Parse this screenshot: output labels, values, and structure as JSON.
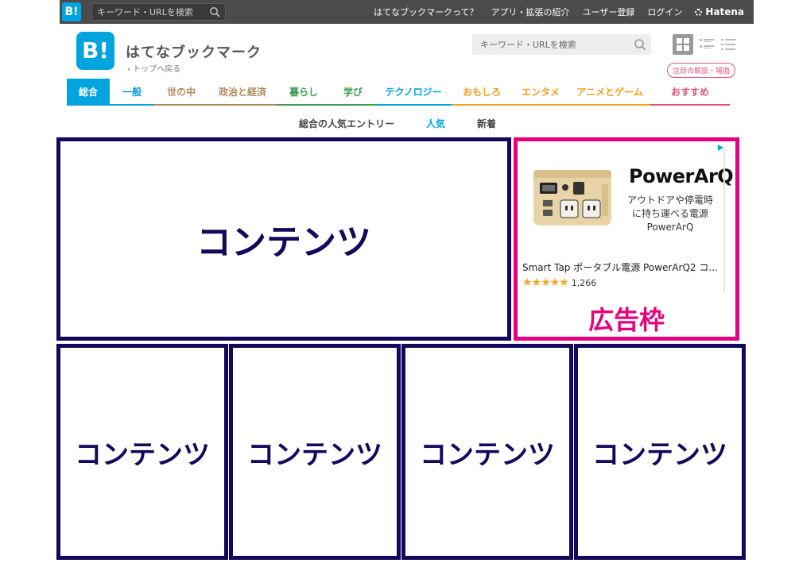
{
  "topbar": {
    "logo": "B!",
    "search_placeholder": "キーワード・URLを検索",
    "links": [
      "はてなブックマークって？",
      "アプリ・拡張の紹介",
      "ユーザー登録",
      "ログイン"
    ],
    "brand": "Hatena"
  },
  "header": {
    "logo": "B!",
    "title": "はてなブックマーク",
    "back_link": "‹  トップへ戻る",
    "search_placeholder": "キーワード・URLを検索",
    "notice_badge": "注目の競技・場面"
  },
  "categories": [
    {
      "label": "総合",
      "color": "#00a4de",
      "active": true
    },
    {
      "label": "一般",
      "color": "#00a4de"
    },
    {
      "label": "世の中",
      "color": "#b08a5e"
    },
    {
      "label": "政治と経済",
      "color": "#b08a5e"
    },
    {
      "label": "暮らし",
      "color": "#3a9c4c"
    },
    {
      "label": "学び",
      "color": "#3a9c4c"
    },
    {
      "label": "テクノロジー",
      "color": "#00a4de"
    },
    {
      "label": "おもしろ",
      "color": "#f0a020"
    },
    {
      "label": "エンタメ",
      "color": "#f0a020"
    },
    {
      "label": "アニメとゲーム",
      "color": "#f0a020"
    },
    {
      "label": "おすすめ",
      "color": "#e0507a"
    }
  ],
  "subnav": {
    "heading": "総合の人気エントリー",
    "popular": "人気",
    "new": "新着"
  },
  "content": {
    "large_label": "コンテンツ",
    "small_labels": [
      "コンテンツ",
      "コンテンツ",
      "コンテンツ",
      "コンテンツ"
    ]
  },
  "ad": {
    "brand": "PowerArQ",
    "description": "アウトドアや停電時に持ち運べる電源PowerArQ",
    "title": "Smart Tap ポータブル電源 PowerArQ2 コ...",
    "rating": 4.5,
    "review_count": "1,266",
    "label": "広告枠"
  },
  "colors": {
    "hatena_blue": "#00a4de",
    "content_border": "#14085c",
    "ad_border": "#e4027f"
  }
}
